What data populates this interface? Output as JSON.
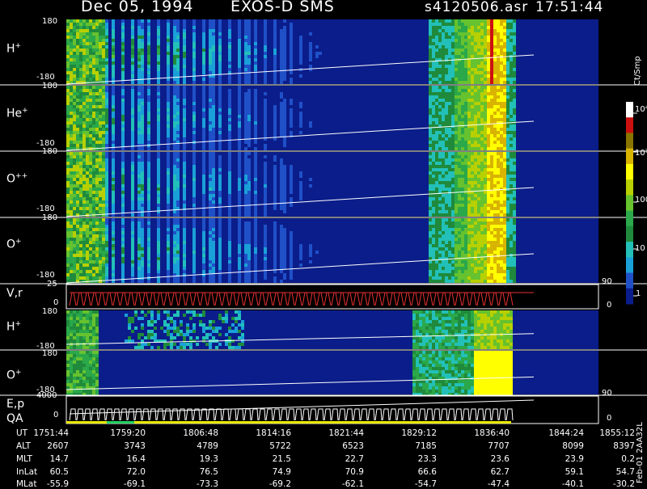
{
  "header": {
    "date": "Dec 05, 1994",
    "mission": "EXOS-D SMS",
    "file": "s4120506.asr",
    "time": "17:51:44"
  },
  "colors": {
    "background": "#000000",
    "plot_bg": "#0b1d8a",
    "palette": [
      "#0a1d8c",
      "#1f50c8",
      "#1aa0d8",
      "#22c0b8",
      "#1f8a3c",
      "#2aa84a",
      "#66c22e",
      "#b8d000",
      "#ffff00",
      "#d8b400",
      "#8a7400",
      "#cc1010",
      "#ffffff"
    ],
    "trace": "#ffffff",
    "velocity_trace": "#e83030",
    "qa_green": "#22d060",
    "qa_yellow": "#e8e800"
  },
  "chart_data": [
    {
      "type": "heatmap",
      "panel": "H+",
      "label": "H",
      "superscript": "+",
      "ylim": [
        -180,
        180
      ],
      "y_ticks": [
        "180",
        "-180"
      ],
      "colorscale": "Ct/Smp"
    },
    {
      "type": "heatmap",
      "panel": "He+",
      "label": "He",
      "superscript": "+",
      "ylim": [
        -180,
        180
      ],
      "y_ticks": [
        "180",
        "-180"
      ],
      "colorscale": "Ct/Smp"
    },
    {
      "type": "heatmap",
      "panel": "O++",
      "label": "O",
      "superscript": "++",
      "ylim": [
        -180,
        180
      ],
      "y_ticks": [
        "180",
        "-180"
      ],
      "colorscale": "Ct/Smp"
    },
    {
      "type": "heatmap",
      "panel": "O+",
      "label": "O",
      "superscript": "+",
      "ylim": [
        -180,
        180
      ],
      "y_ticks": [
        "180",
        "-180"
      ],
      "colorscale": "Ct/Smp"
    },
    {
      "type": "line",
      "panel": "V,r",
      "label": "V,r",
      "left_ticks": [
        "25",
        "0"
      ],
      "right_ticks": [
        "90",
        "0"
      ]
    },
    {
      "type": "heatmap",
      "panel": "H+ (2)",
      "label": "H",
      "superscript": "+",
      "ylim": [
        -180,
        180
      ],
      "y_ticks": [
        "180",
        "-180"
      ]
    },
    {
      "type": "heatmap",
      "panel": "O+ (2)",
      "label": "O",
      "superscript": "+",
      "ylim": [
        -180,
        180
      ],
      "y_ticks": [
        "180",
        "-180"
      ]
    },
    {
      "type": "line",
      "panel": "E,p QA",
      "label": "E,p",
      "label2": "QA",
      "left_ticks": [
        "4000",
        "0"
      ],
      "right_ticks": [
        "90",
        "0"
      ]
    },
    {
      "type": "table",
      "row_labels": [
        "UT",
        "ALT",
        "MLT",
        "InLat",
        "MLat"
      ],
      "columns": [
        {
          "UT": "1751:44",
          "ALT": "2607",
          "MLT": "14.7",
          "InLat": "60.5",
          "MLat": "-55.9"
        },
        {
          "UT": "1759:20",
          "ALT": "3743",
          "MLT": "16.4",
          "InLat": "72.0",
          "MLat": "-69.1"
        },
        {
          "UT": "1806:48",
          "ALT": "4789",
          "MLT": "19.3",
          "InLat": "76.5",
          "MLat": "-73.3"
        },
        {
          "UT": "1814:16",
          "ALT": "5722",
          "MLT": "21.5",
          "InLat": "74.9",
          "MLat": "-69.2"
        },
        {
          "UT": "1821:44",
          "ALT": "6523",
          "MLT": "22.7",
          "InLat": "70.9",
          "MLat": "-62.1"
        },
        {
          "UT": "1829:12",
          "ALT": "7185",
          "MLT": "23.3",
          "InLat": "66.6",
          "MLat": "-54.7"
        },
        {
          "UT": "1836:40",
          "ALT": "7707",
          "MLT": "23.6",
          "InLat": "62.7",
          "MLat": "-47.4"
        },
        {
          "UT": "1844:24",
          "ALT": "8099",
          "MLT": "23.9",
          "InLat": "59.1",
          "MLat": "-40.1"
        },
        {
          "UT": "1855:12",
          "ALT": "8397",
          "MLT": "0.2",
          "InLat": "54.7",
          "MLat": "-30.2"
        }
      ]
    },
    {
      "type": "colorbar",
      "unit": "Ct/Smp",
      "ticks": [
        "1",
        "10",
        "100",
        "10³",
        "10⁴"
      ]
    }
  ],
  "footer_vertical": "Feb-01 2AA32L"
}
